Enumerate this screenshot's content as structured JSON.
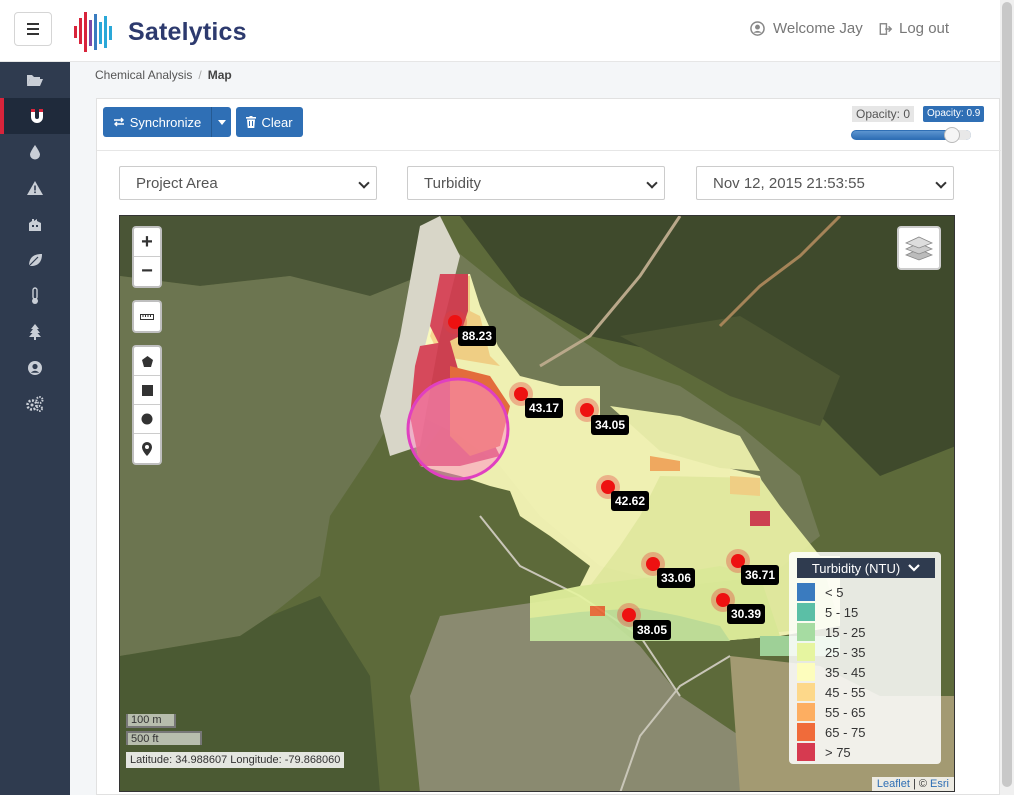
{
  "header": {
    "brand": "Satelytics",
    "welcome": "Welcome Jay",
    "logout": "Log out"
  },
  "sidebar": {
    "items": [
      {
        "icon": "folder-open-icon",
        "active": false
      },
      {
        "icon": "magnet-icon",
        "active": true
      },
      {
        "icon": "tint-icon",
        "active": false
      },
      {
        "icon": "warning-icon",
        "active": false
      },
      {
        "icon": "factory-icon",
        "active": false
      },
      {
        "icon": "leaf-icon",
        "active": false
      },
      {
        "icon": "thermometer-icon",
        "active": false
      },
      {
        "icon": "tree-icon",
        "active": false
      },
      {
        "icon": "user-circle-icon",
        "active": false
      },
      {
        "icon": "cogs-icon",
        "active": false
      }
    ]
  },
  "breadcrumb": {
    "parent": "Chemical Analysis",
    "current": "Map"
  },
  "toolbar": {
    "synchronize": "Synchronize",
    "clear": "Clear",
    "opacity_min_label": "Opacity: 0",
    "opacity_max_label": "Opacity: 0.9",
    "opacity_value": 0.9
  },
  "filters": {
    "area": "Project Area",
    "parameter": "Turbidity",
    "datetime": "Nov 12, 2015 21:53:55"
  },
  "map": {
    "samples": [
      "88.23",
      "43.17",
      "34.05",
      "42.62",
      "33.06",
      "36.71",
      "30.39",
      "38.05"
    ],
    "legend_title": "Turbidity (NTU)",
    "legend": [
      {
        "label": "< 5",
        "color": "#3a7bbf"
      },
      {
        "label": "5 - 15",
        "color": "#5bbfa6"
      },
      {
        "label": "15 - 25",
        "color": "#a6dca2"
      },
      {
        "label": "25 - 35",
        "color": "#e6f5a0"
      },
      {
        "label": "35 - 45",
        "color": "#fdfdbd"
      },
      {
        "label": "45 - 55",
        "color": "#fdd88a"
      },
      {
        "label": "55 - 65",
        "color": "#fdae61"
      },
      {
        "label": "65 - 75",
        "color": "#f06b3a"
      },
      {
        "label": "> 75",
        "color": "#d63a50"
      }
    ],
    "scale_m": "100 m",
    "scale_ft": "500 ft",
    "coords": "Latitude: 34.988607 Longitude: -79.868060",
    "attrib_leaflet": "Leaflet",
    "attrib_sep": " | © ",
    "attrib_esri": "Esri"
  }
}
